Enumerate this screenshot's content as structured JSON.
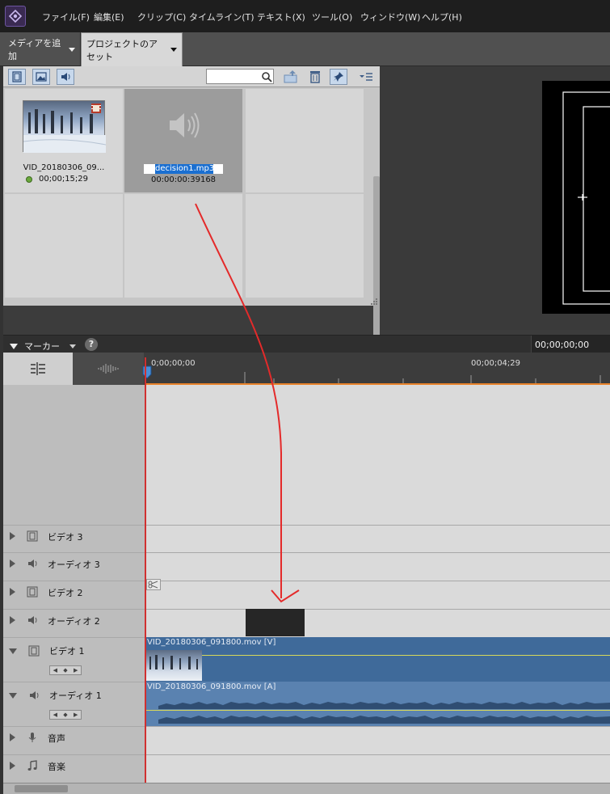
{
  "menu": {
    "items": [
      "ファイル(F)",
      "編集(E)",
      "クリップ(C)",
      "タイムライン(T)",
      "テキスト(X)",
      "ツール(O)",
      "ウィンドウ(W)",
      "ヘルプ(H)"
    ]
  },
  "asset_bar": {
    "add_media": "メディアを追加",
    "project_assets": "プロジェクトのアセット"
  },
  "assets": {
    "search_placeholder": "",
    "items": [
      {
        "name": "VID_20180306_09...",
        "duration": "00;00;15;29"
      },
      {
        "name": "decision1.mp3",
        "duration": "00:00:00:39168"
      }
    ]
  },
  "marker_bar": {
    "marker_label": "マーカー",
    "help": "?",
    "timecode": "00;00;00;00"
  },
  "ruler": {
    "start": "0;00;00;00",
    "mark": "00;00;04;29"
  },
  "tracks": {
    "video3": "ビデオ 3",
    "audio3": "オーディオ 3",
    "video2": "ビデオ 2",
    "audio2": "オーディオ 2",
    "video1": "ビデオ 1",
    "audio1": "オーディオ 1",
    "narration": "音声",
    "music": "音楽"
  },
  "clips": {
    "video1_title": "VID_20180306_091800.mov [V]",
    "audio1_title": "VID_20180306_091800.mov [A]"
  },
  "colors": {
    "clip_video": "#3f6a9a",
    "clip_audio": "#5a82b0",
    "playhead": "#d03030",
    "annotation_arrow": "#e42a2a",
    "selection_highlight": "#1a6fd1"
  }
}
